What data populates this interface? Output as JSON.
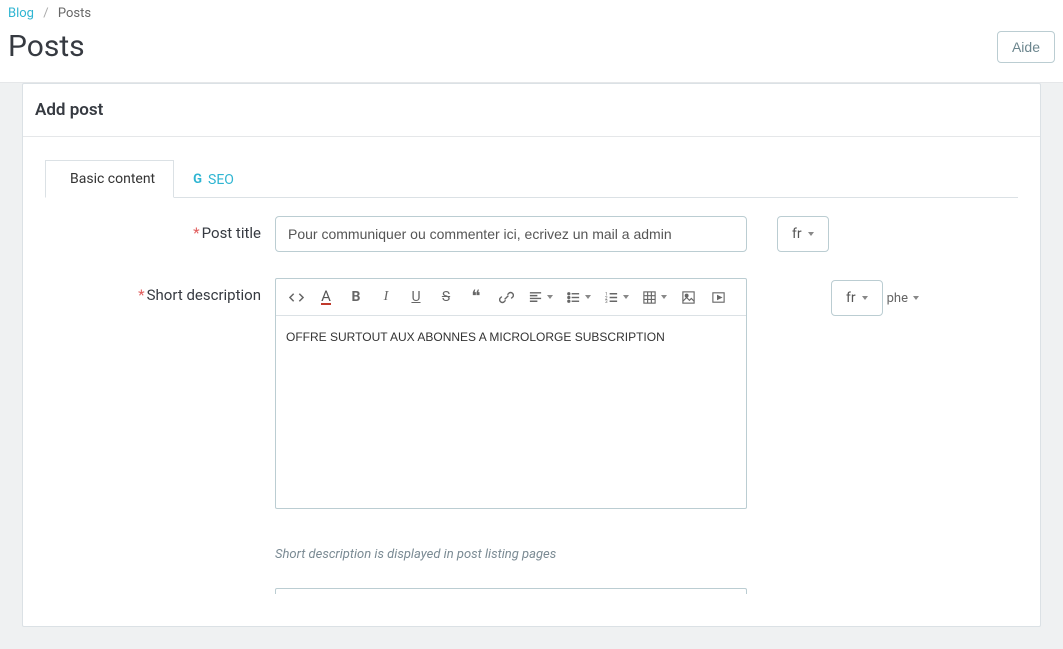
{
  "breadcrumb": {
    "blog": "Blog",
    "posts": "Posts"
  },
  "header": {
    "title": "Posts",
    "help": "Aide"
  },
  "panel": {
    "title": "Add post"
  },
  "tabs": {
    "basic": "Basic content",
    "seo": "SEO"
  },
  "form": {
    "post_title_label": "Post title",
    "post_title_value": "Pour communiquer ou commenter ici, ecrivez un mail a admin",
    "short_desc_label": "Short description",
    "short_desc_value": "OFFRE SURTOUT AUX ABONNES A MICROLORGE SUBSCRIPTION",
    "short_desc_help": "Short description is displayed in post listing pages",
    "lang": "fr",
    "editor_extra": "phe"
  }
}
